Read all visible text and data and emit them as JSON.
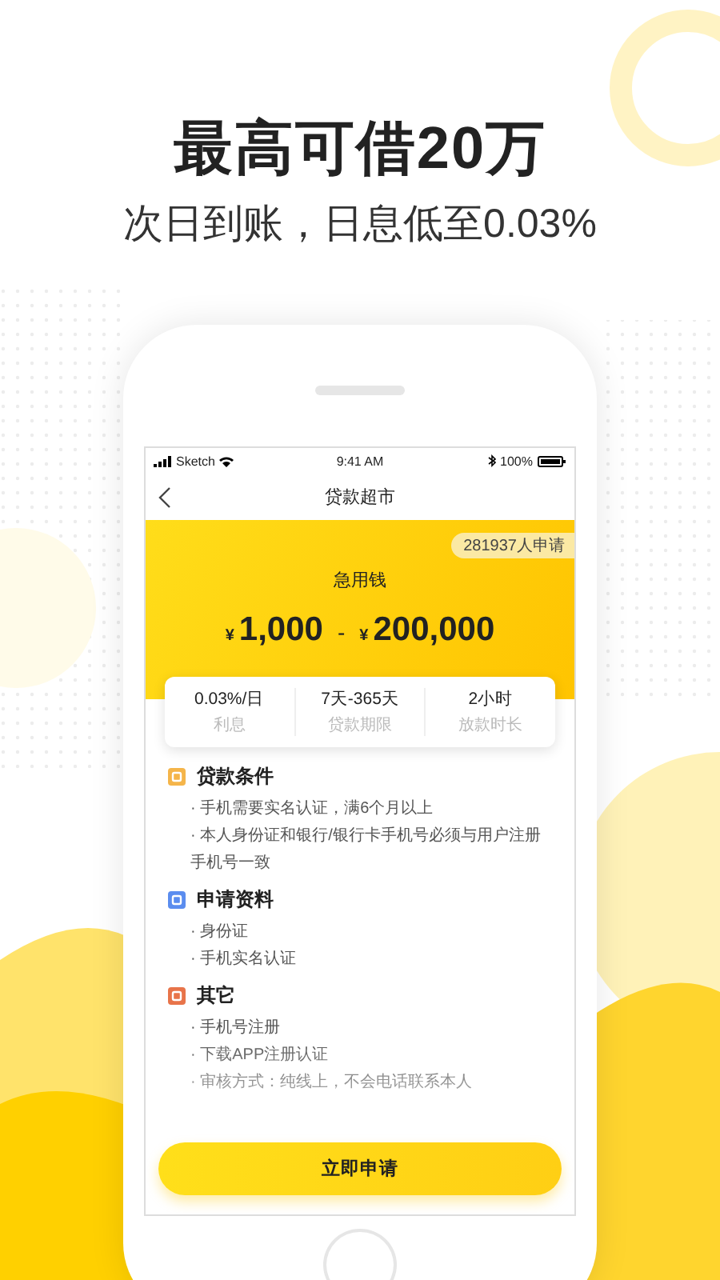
{
  "promo": {
    "headline": "最高可借20万",
    "subheadline": "次日到账，日息低至0.03%"
  },
  "status_bar": {
    "carrier": "Sketch",
    "time": "9:41 AM",
    "battery": "100%"
  },
  "nav": {
    "title": "贷款超市"
  },
  "hero": {
    "badge": "281937人申请",
    "product": "急用钱",
    "min_currency": "¥",
    "min": "1,000",
    "separator": "-",
    "max_currency": "¥",
    "max": "200,000"
  },
  "stats": [
    {
      "value": "0.03%/日",
      "label": "利息"
    },
    {
      "value": "7天-365天",
      "label": "贷款期限"
    },
    {
      "value": "2小时",
      "label": "放款时长"
    }
  ],
  "sections": [
    {
      "title": "贷款条件",
      "color": "#f5b54a",
      "items": [
        "· 手机需要实名认证，满6个月以上",
        "· 本人身份证和银行/银行卡手机号必须与用户注册手机号一致"
      ]
    },
    {
      "title": "申请资料",
      "color": "#5b8def",
      "items": [
        "· 身份证",
        "· 手机实名认证"
      ]
    },
    {
      "title": "其它",
      "color": "#e8744a",
      "items": [
        "· 手机号注册",
        "· 下载APP注册认证",
        "· 审核方式：纯线上，不会电话联系本人"
      ]
    }
  ],
  "apply_button": "立即申请"
}
